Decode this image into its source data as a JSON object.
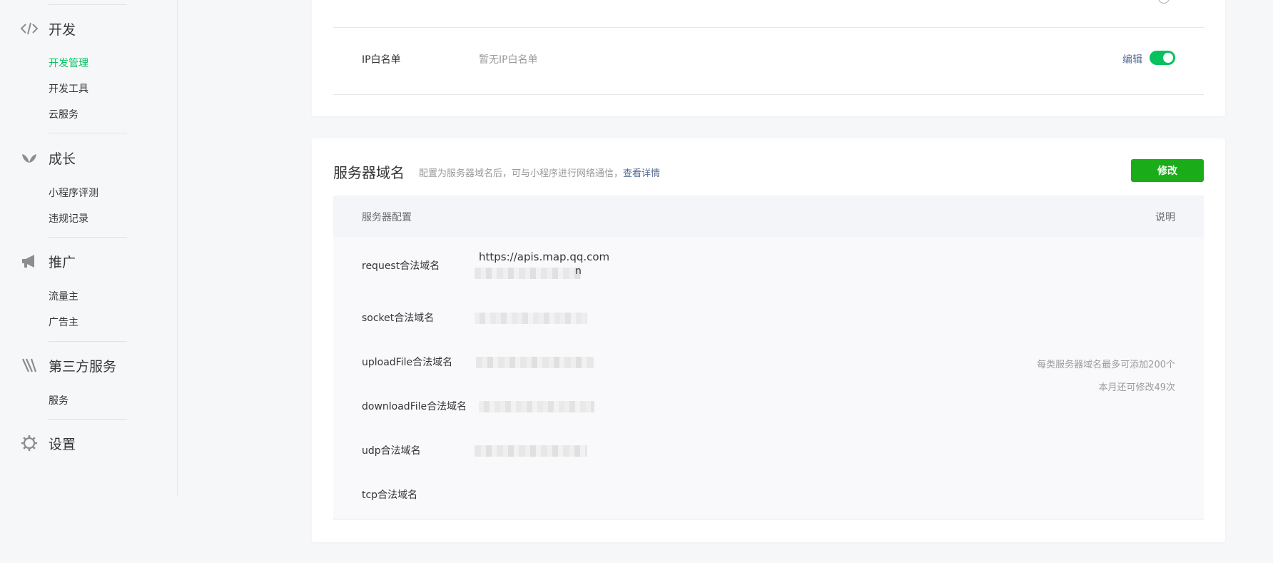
{
  "sidebar": {
    "groups": [
      {
        "label": "开发",
        "icon": "code-icon",
        "items": [
          {
            "label": "开发管理",
            "active": true
          },
          {
            "label": "开发工具",
            "active": false
          },
          {
            "label": "云服务",
            "active": false
          }
        ]
      },
      {
        "label": "成长",
        "icon": "sprout-icon",
        "items": [
          {
            "label": "小程序评测",
            "active": false
          },
          {
            "label": "违规记录",
            "active": false
          }
        ]
      },
      {
        "label": "推广",
        "icon": "megaphone-icon",
        "items": [
          {
            "label": "流量主",
            "active": false
          },
          {
            "label": "广告主",
            "active": false
          }
        ]
      },
      {
        "label": "第三方服务",
        "icon": "third-party-icon",
        "items": [
          {
            "label": "服务",
            "active": false
          }
        ]
      },
      {
        "label": "设置",
        "icon": "gear-icon",
        "items": []
      }
    ]
  },
  "ip_whitelist": {
    "label": "IP白名单",
    "value": "暂无IP白名单",
    "edit_label": "编辑",
    "enabled": true
  },
  "server_domain": {
    "title": "服务器域名",
    "description": "配置为服务器域名后，可与小程序进行网络通信，",
    "details_link": "查看详情",
    "modify_button": "修改",
    "table_headers": {
      "config": "服务器配置",
      "note": "说明"
    },
    "rows": [
      {
        "label": "request合法域名",
        "value": "https://apis.map.qq.com",
        "extra_tail": "n"
      },
      {
        "label": "socket合法域名"
      },
      {
        "label": "uploadFile合法域名"
      },
      {
        "label": "downloadFile合法域名"
      },
      {
        "label": "udp合法域名"
      },
      {
        "label": "tcp合法域名"
      }
    ],
    "notes": [
      "每类服务器域名最多可添加200个",
      "本月还可修改49次"
    ]
  },
  "colors": {
    "accent_green": "#07c160",
    "button_green": "#1aad19",
    "link_blue": "#576b95",
    "muted_text": "#9a9a9a"
  }
}
